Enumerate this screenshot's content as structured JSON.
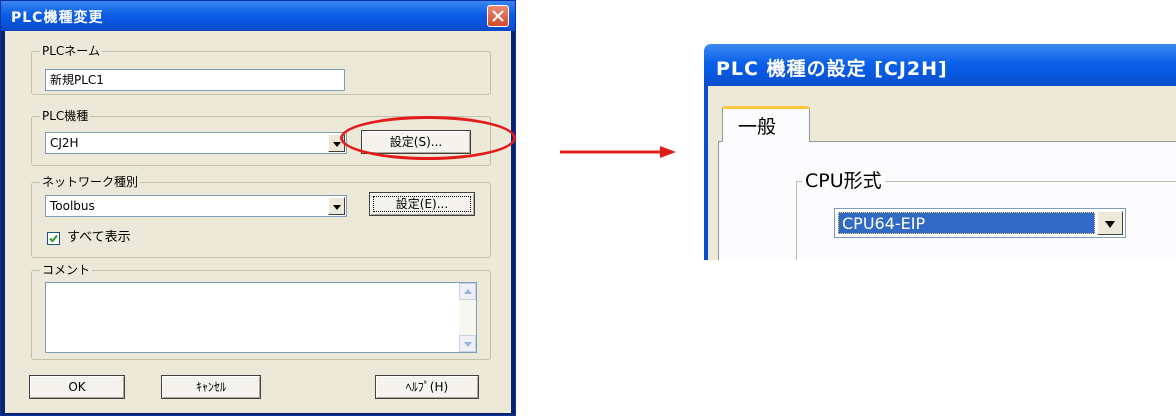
{
  "dialog_left": {
    "title": "PLC機種変更",
    "plc_name": {
      "group_label": "PLCネーム",
      "value": "新規PLC1"
    },
    "plc_model": {
      "group_label": "PLC機種",
      "selected": "CJ2H",
      "settings_button": "設定(S)..."
    },
    "network": {
      "group_label": "ネットワーク種別",
      "selected": "Toolbus",
      "settings_button": "設定(E)...",
      "show_all_label": "すべて表示",
      "show_all_checked": true
    },
    "comment": {
      "group_label": "コメント",
      "value": ""
    },
    "buttons": {
      "ok": "OK",
      "cancel": "ｷｬﾝｾﾙ",
      "help": "ﾍﾙﾌﾟ(H)"
    }
  },
  "dialog_right": {
    "title": "PLC 機種の設定 [CJ2H]",
    "tab_label": "一般",
    "cpu_group_label": "CPU形式",
    "cpu_selected": "CPU64-EIP"
  },
  "colors": {
    "highlight": "#e21b1b",
    "title_bar": "#0b5ee6",
    "selection": "#316ac5"
  }
}
